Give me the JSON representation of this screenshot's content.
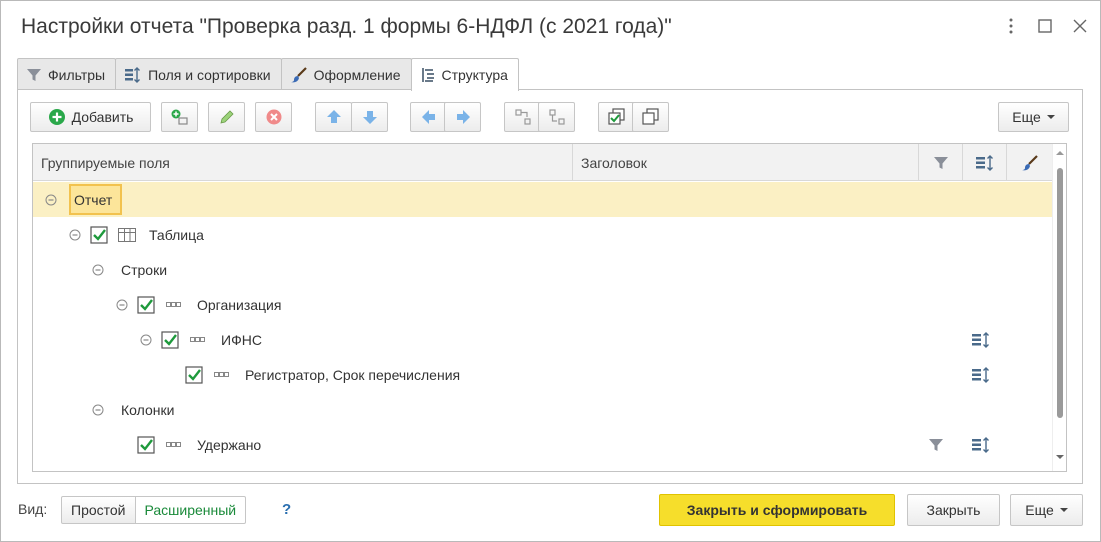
{
  "window": {
    "title": "Настройки отчета \"Проверка разд. 1 формы 6-НДФЛ (с 2021 года)\""
  },
  "tabs": [
    {
      "label": "Фильтры",
      "icon": "filter-icon"
    },
    {
      "label": "Поля и сортировки",
      "icon": "fields-sort-icon"
    },
    {
      "label": "Оформление",
      "icon": "brush-icon"
    },
    {
      "label": "Структура",
      "icon": "structure-icon",
      "active": true
    }
  ],
  "toolbar": {
    "add_label": "Добавить",
    "more_label": "Еще"
  },
  "grid": {
    "headers": {
      "fields": "Группируемые поля",
      "caption": "Заголовок"
    },
    "rows": [
      {
        "label": "Отчет",
        "selected": true
      },
      {
        "label": "Таблица",
        "checked": true
      },
      {
        "label": "Строки"
      },
      {
        "label": "Организация",
        "checked": true
      },
      {
        "label": "ИФНС",
        "checked": true,
        "sort_icon": true
      },
      {
        "label": "Регистратор, Срок перечисления",
        "checked": true,
        "sort_icon": true
      },
      {
        "label": "Колонки"
      },
      {
        "label": "Удержано",
        "checked": true,
        "filter_icon": true,
        "sort_icon": true
      }
    ]
  },
  "footer": {
    "view_label": "Вид:",
    "view_simple": "Простой",
    "view_extended": "Расширенный",
    "help": "?",
    "primary_button": "Закрыть и сформировать",
    "close_button": "Закрыть",
    "more_button": "Еще"
  },
  "colors": {
    "accent_yellow": "#f6de2b",
    "selected_row": "#fbf0c4",
    "check_green": "#1e9a3c",
    "extended_green": "#1a8a3a"
  }
}
